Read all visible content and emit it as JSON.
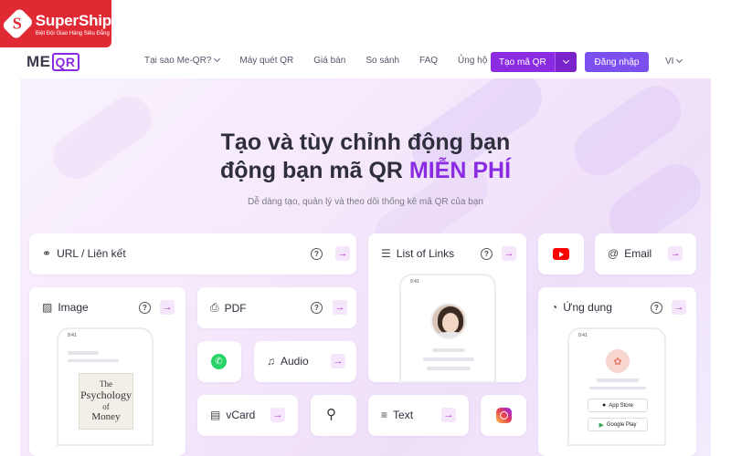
{
  "badge": {
    "name": "SuperShip",
    "tagline": "Biệt Đội Giao Hàng Siêu Đẳng",
    "mark": "S"
  },
  "header": {
    "logo_left": "ME",
    "logo_right": "QR",
    "nav": [
      {
        "label": "Tại sao Me-QR?",
        "has_dropdown": true
      },
      {
        "label": "Máy quét QR"
      },
      {
        "label": "Giá bán"
      },
      {
        "label": "So sánh"
      },
      {
        "label": "FAQ"
      },
      {
        "label": "Ủng hộ"
      }
    ],
    "create_button": "Tạo mã QR",
    "login_button": "Đăng nhập",
    "language": "VI"
  },
  "hero": {
    "title_line1": "Tạo và tùy chỉnh động bạn",
    "title_line2_prefix": "động bạn mã QR ",
    "title_accent": "MIỄN PHÍ",
    "subtitle": "Dễ dàng tạo, quản lý và theo dõi thống kê mã QR của bạn"
  },
  "cards": {
    "url": "URL / Liên kết",
    "list_of_links": "List of Links",
    "email": "Email",
    "image": "Image",
    "pdf": "PDF",
    "app": "Ứng dụng",
    "audio": "Audio",
    "vcard": "vCard",
    "text": "Text"
  },
  "mockups": {
    "time": "9:41",
    "book_line1": "The",
    "book_line2": "Psychology",
    "book_line3": "Money",
    "app_store": "App Store",
    "google_play": "Google Play"
  },
  "icons": {
    "help": "?",
    "arrow": "→"
  },
  "colors": {
    "brand_red": "#e02a33",
    "accent_purple": "#8a2be2",
    "login_blue": "#7b4ff0"
  }
}
